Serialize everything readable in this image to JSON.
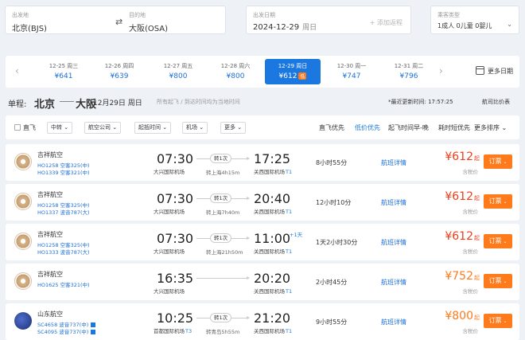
{
  "search": {
    "origin_label": "出发地",
    "origin": "北京(BJS)",
    "swap_icon": "swap-icon",
    "dest_label": "目的地",
    "dest": "大阪(OSA)",
    "date_label": "出发日期",
    "date": "2024-12-29",
    "weekday": "周日",
    "add_return": "+ 添加返程",
    "pax_label": "乘客类型",
    "pax": "1成人  0儿童  0婴儿"
  },
  "date_strip": {
    "prev_icon": "chevron-left-icon",
    "next_icon": "chevron-right-icon",
    "days": [
      {
        "date": "12-25 周三",
        "price": "¥641"
      },
      {
        "date": "12-26 周四",
        "price": "¥639"
      },
      {
        "date": "12-27 周五",
        "price": "¥800"
      },
      {
        "date": "12-28 周六",
        "price": "¥800"
      },
      {
        "date": "12-29 周日",
        "price": "¥612",
        "badge": "低"
      },
      {
        "date": "12-30 周一",
        "price": "¥747"
      },
      {
        "date": "12-31 周二",
        "price": "¥796"
      }
    ],
    "active_index": 4,
    "more_dates": "更多日期"
  },
  "route": {
    "tag": "单程:",
    "from": "北京",
    "to": "大阪",
    "date": "12月29日 周日",
    "hint": "所有起飞 / 到达时间均为当地时间",
    "updated": "*最近更新时间: 17:57:25",
    "compare": "航司比价表"
  },
  "filters": {
    "direct": "直飞",
    "buttons": [
      "中转",
      "航空公司",
      "起抵时间",
      "机场",
      "更多"
    ],
    "sorts": [
      "直飞优先",
      "低价优先",
      "起飞时间早-晚",
      "耗时短优先",
      "更多排序"
    ],
    "active_sort": 1
  },
  "flights": [
    {
      "airline": "吉祥航空",
      "logo": "jx",
      "codes": [
        "HO1258 空客325(中)",
        "HO1339 空客321(中)"
      ],
      "dep_time": "07:30",
      "dep_airport": "大兴国际机场",
      "dep_term": "",
      "stops": "转1次",
      "via": "转上海4h15m",
      "arr_time": "17:25",
      "arr_airport": "关西国际机场",
      "arr_term": "T1",
      "plus_day": "",
      "duration": "8小时55分",
      "detail": "航班详情",
      "price": "¥612",
      "price_suffix": "起",
      "tax": "含税价",
      "book": "订票"
    },
    {
      "airline": "吉祥航空",
      "logo": "jx",
      "codes": [
        "HO1258 空客325(中)",
        "HO1337 波音787(大)"
      ],
      "dep_time": "07:30",
      "dep_airport": "大兴国际机场",
      "dep_term": "",
      "stops": "转1次",
      "via": "转上海7h40m",
      "arr_time": "20:40",
      "arr_airport": "关西国际机场",
      "arr_term": "T1",
      "plus_day": "",
      "duration": "12小时10分",
      "detail": "航班详情",
      "price": "¥612",
      "price_suffix": "起",
      "tax": "含税价",
      "book": "订票"
    },
    {
      "airline": "吉祥航空",
      "logo": "jx",
      "codes": [
        "HO1258 空客325(中)",
        "HO1333 波音787(大)"
      ],
      "dep_time": "07:30",
      "dep_airport": "大兴国际机场",
      "dep_term": "",
      "stops": "转1次",
      "via": "转上海21h50m",
      "arr_time": "11:00",
      "arr_airport": "关西国际机场",
      "arr_term": "T1",
      "plus_day": "+1天",
      "duration": "1天2小时30分",
      "detail": "航班详情",
      "price": "¥612",
      "price_suffix": "起",
      "tax": "含税价",
      "book": "订票"
    },
    {
      "airline": "吉祥航空",
      "logo": "jx",
      "codes": [
        "HO1625 空客321(中)"
      ],
      "dep_time": "16:35",
      "dep_airport": "大兴国际机场",
      "dep_term": "",
      "stops": "",
      "via": "",
      "arr_time": "20:20",
      "arr_airport": "关西国际机场",
      "arr_term": "T1",
      "plus_day": "",
      "duration": "2小时45分",
      "detail": "航班详情",
      "price": "¥752",
      "price_suffix": "起",
      "tax": "含税价",
      "book": "订票"
    },
    {
      "airline": "山东航空",
      "logo": "sd",
      "codes": [
        "SC4658 波音737(中)",
        "SC4095 波音737(中)"
      ],
      "dep_time": "10:25",
      "dep_airport": "首都国际机场",
      "dep_term": "T3",
      "stops": "转1次",
      "via": "转青岛5h55m",
      "arr_time": "21:20",
      "arr_airport": "关西国际机场",
      "arr_term": "T1",
      "plus_day": "",
      "duration": "9小时55分",
      "detail": "航班详情",
      "price": "¥800",
      "price_suffix": "起",
      "tax": "含税价",
      "book": "订票"
    }
  ],
  "colors": {
    "accent": "#1b78e0",
    "price_red": "#f03c18",
    "price_orange": "#ff7a1a"
  }
}
